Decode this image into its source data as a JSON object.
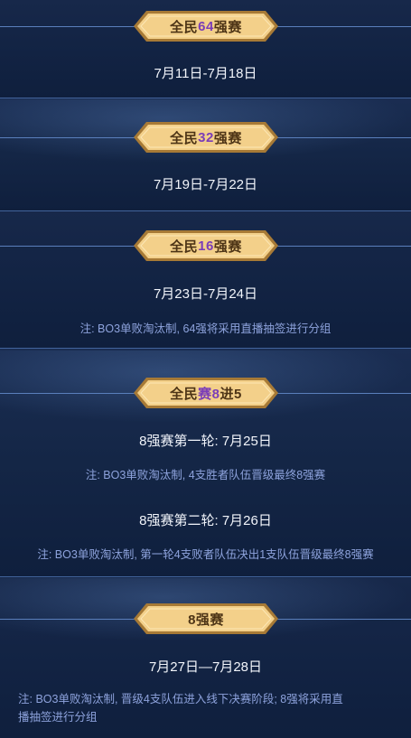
{
  "stages": [
    {
      "badge_prefix": "全民",
      "badge_accent": "64",
      "badge_suffix": "强赛",
      "date": "7月11日-7月18日"
    },
    {
      "badge_prefix": "全民",
      "badge_accent": "32",
      "badge_suffix": "强赛",
      "date": "7月19日-7月22日"
    },
    {
      "badge_prefix": "全民",
      "badge_accent": "16",
      "badge_suffix": "强赛",
      "date": "7月23日-7月24日",
      "note": "注: BO3单败淘汰制, 64强将采用直播抽签进行分组"
    },
    {
      "badge_prefix": "全民",
      "badge_accent": "赛8",
      "badge_suffix": "进5",
      "round1": "8强赛第一轮: 7月25日",
      "note1": "注: BO3单败淘汰制, 4支胜者队伍晋级最终8强赛",
      "round2": "8强赛第二轮: 7月26日",
      "note2": "注: BO3单败淘汰制, 第一轮4支败者队伍决出1支队伍晋级最终8强赛"
    },
    {
      "badge_prefix": "",
      "badge_accent": "",
      "badge_suffix": "8强赛",
      "date": "7月27日—7月28日",
      "note_line1": "注: BO3单败淘汰制, 晋级4支队伍进入线下决赛阶段; 8强将采用直",
      "note_line2": "播抽签进行分组"
    }
  ],
  "colors": {
    "background": "#0f1e3c",
    "badge_gold": "#f3d08a",
    "badge_text": "#4d3416",
    "badge_accent": "#7a3db8",
    "note_text": "#8ea3dd",
    "divider": "#4a6faa"
  }
}
